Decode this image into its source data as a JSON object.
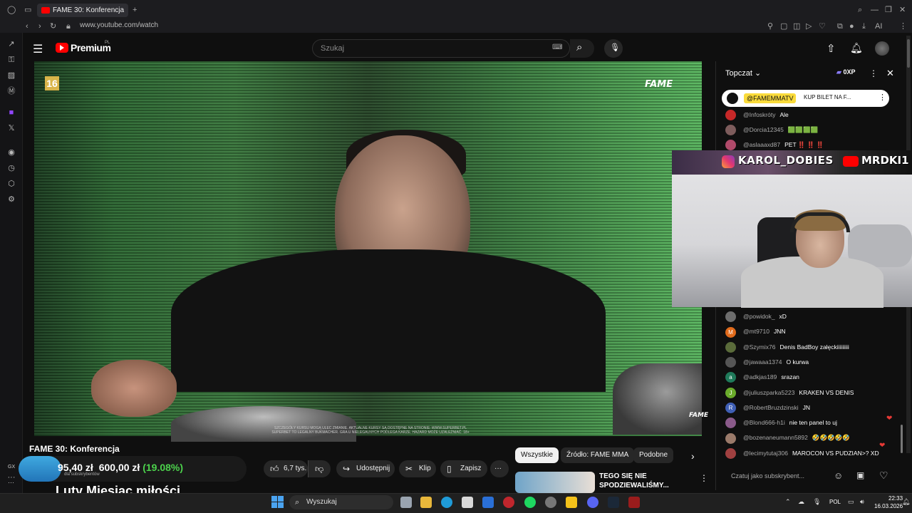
{
  "browser": {
    "tab_title": "FAME 30: Konferencja",
    "url": "www.youtube.com/watch",
    "toolbar_ai_label": "AI"
  },
  "youtube": {
    "logo_text": "Premium",
    "logo_region": "PL",
    "search_placeholder": "Szukaj"
  },
  "video": {
    "age_badge": "16",
    "brand_logo": "FAME",
    "brand_logo_small": "FAME",
    "disclaimer_line1": "SZCZEGÓŁY KURSU MOGĄ ULEC ZMIANIE. AKTUALNE KURSY SĄ DOSTĘPNE NA STRONIE: WWW.SUPERBET.PL",
    "disclaimer_line2": "SUPERBET TO LEGALNY BUKMACHER. GRA U NIELEGALNYCH PODLEGA KARZE. HAZARD MOŻE UZALEŻNIAĆ. 18+",
    "title": "FAME 30: Konferencja"
  },
  "actions": {
    "like_count": "6,7 tys.",
    "share": "Udostępnij",
    "clip": "Klip",
    "save": "Zapisz",
    "more": "···"
  },
  "stream_overlay": {
    "prefix": "GX",
    "price_current": "95,40 zł",
    "price_target": "600,00 zł",
    "percent": "(19.08%)",
    "sub_caption": "dla subskrybentów",
    "banner": "Luty Miesiąc miłości"
  },
  "chips": [
    "Wszystkie",
    "Źródło: FAME MMA",
    "Podobne"
  ],
  "recommendation": {
    "title_line1": "TEGO SIĘ NIE",
    "title_line2": "SPODZIEWALIŚMY..."
  },
  "chat": {
    "header": "Topczat",
    "oxp_badge": "0XP",
    "pinned_user": "@FAMEMMATV",
    "pinned_msg": "KUP BILET NA F...",
    "messages_top": [
      {
        "user": "@Infoskróty",
        "text": "Ale",
        "color": "#c62828"
      },
      {
        "user": "@Dorcia12345",
        "text": "🟩🟩🟩🟩",
        "color": "#7d5c5c"
      },
      {
        "user": "@aslaaaxd87",
        "text": "PET ‼️ ‼️ ‼️",
        "color": "#b04a6a"
      }
    ],
    "messages": [
      {
        "user": "@powidok_",
        "text": "xD",
        "color": "#6d6d6d",
        "initial": ""
      },
      {
        "user": "@mt9710",
        "text": "JNN",
        "color": "#e06a1b",
        "initial": "M"
      },
      {
        "user": "@Szymix76",
        "text": "Denis BadBoy załęckiiiiiiiii",
        "color": "#5a6b3a",
        "initial": ""
      },
      {
        "user": "@jawaaa1374",
        "text": "O kurwa",
        "color": "#555",
        "initial": ""
      },
      {
        "user": "@adkjas189",
        "text": "srazan",
        "color": "#1f7a5a",
        "initial": "a"
      },
      {
        "user": "@juliuszparka5223",
        "text": "KRAKEN VS DENIS",
        "color": "#6aab2b",
        "initial": "J"
      },
      {
        "user": "@RobertBruzdzinski",
        "text": "JN",
        "color": "#3f5fb5",
        "initial": "R"
      },
      {
        "user": "@Blond666-h1i",
        "text": "nie ten panel to uj",
        "color": "#8a5a8a",
        "initial": ""
      },
      {
        "user": "@bozenaneumann5892",
        "text": "🤣🤣🤣🤣🤣",
        "color": "#9a7a6a",
        "initial": ""
      },
      {
        "user": "@lecimytutaj306",
        "text": "MAROCON VS PUDZIAN>? XD",
        "color": "#a04040",
        "initial": ""
      }
    ],
    "input_placeholder": "Czatuj jako subskrybent..."
  },
  "webcam": {
    "instagram_handle": "KAROL_DOBIES",
    "youtube_handle": "MRDKI1"
  },
  "taskbar": {
    "search": "Wyszukaj",
    "lang": "POL",
    "time": "22:33",
    "date": "16.03.2026"
  }
}
